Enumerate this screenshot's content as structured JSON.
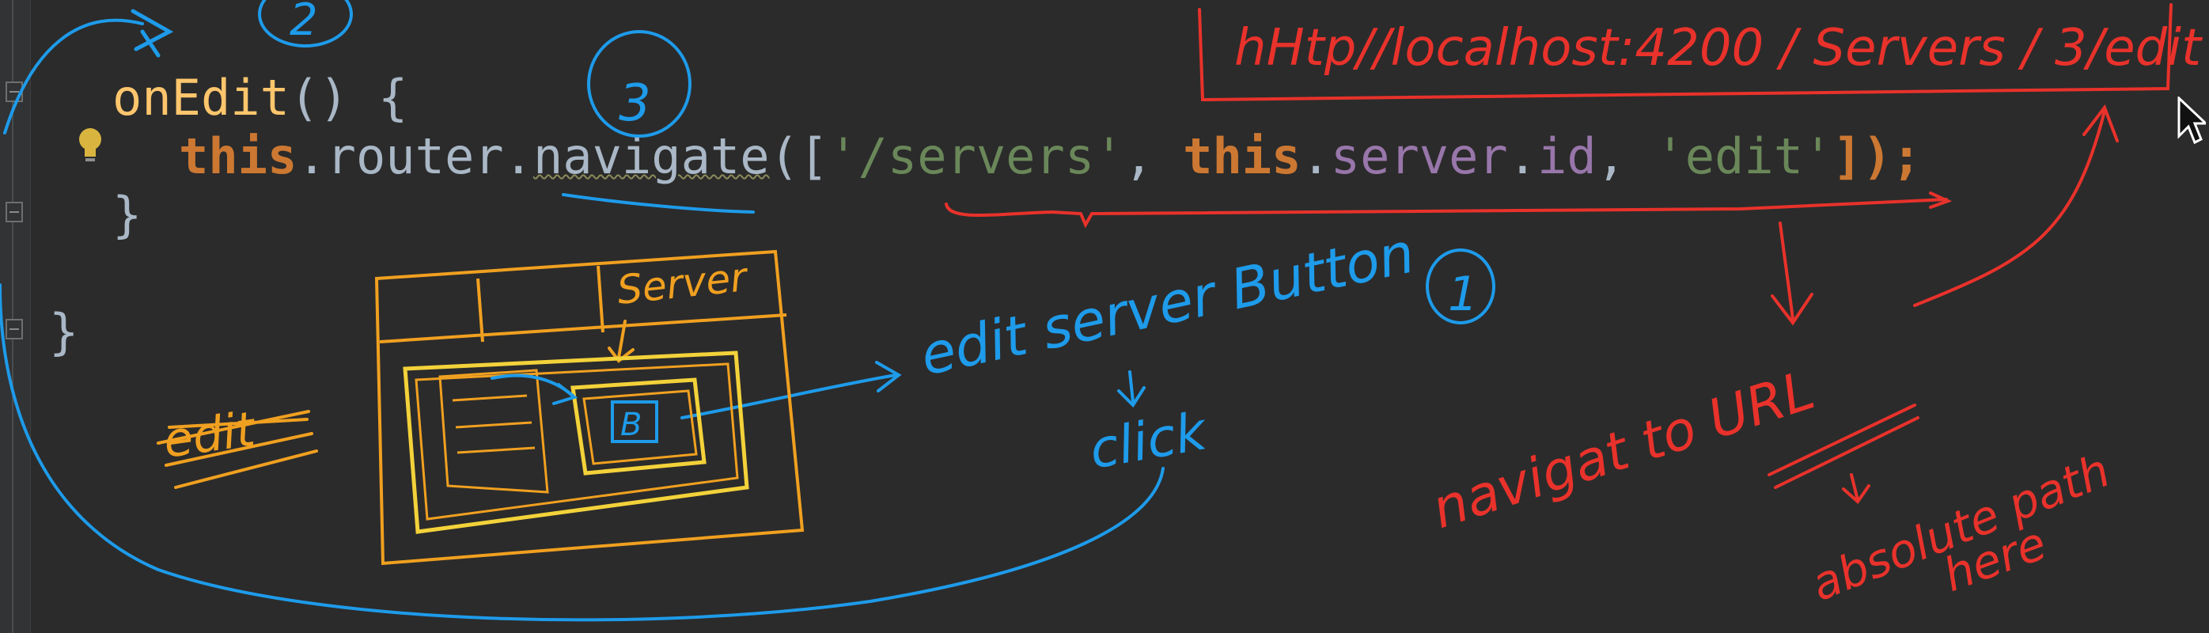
{
  "code": {
    "line1": {
      "method": "onEdit",
      "signature": "() {"
    },
    "line2": {
      "this1": "this",
      "dot1": ".",
      "router": "router",
      "dot2": ".",
      "navigate": "navigate",
      "open": "([",
      "servers_str": "'/servers'",
      "comma1": ", ",
      "this2": "this",
      "dot3": ".",
      "server": "server",
      "dot4": ".",
      "id": "id",
      "comma2": ", ",
      "edit_str": "'edit'",
      "close": "]);"
    },
    "line3": "}",
    "line4": "}"
  },
  "annotations": {
    "url": "hHtp//localhost:4200 / Servers / 3/edit",
    "step1": "1",
    "step2": "2",
    "step3": "3",
    "edit_server_button": "edit server Button",
    "click": "click",
    "servers_label": "Server",
    "button_label": "B",
    "edit_label": "edit",
    "navigate_to_url": "navigat to URL",
    "absolute_path": "absolute path",
    "here": "here"
  },
  "colors": {
    "editor_bg": "#2b2b2b",
    "keyword": "#cc7832",
    "method": "#ffc66d",
    "string": "#6a8759",
    "property": "#9876aa",
    "ink_blue": "#1e9bea",
    "ink_red": "#e8322b",
    "ink_orange": "#f0a020",
    "ink_yellow": "#f3d23a"
  },
  "icons": [
    "lightbulb-icon",
    "mouse-cursor-icon",
    "fold-icon"
  ]
}
